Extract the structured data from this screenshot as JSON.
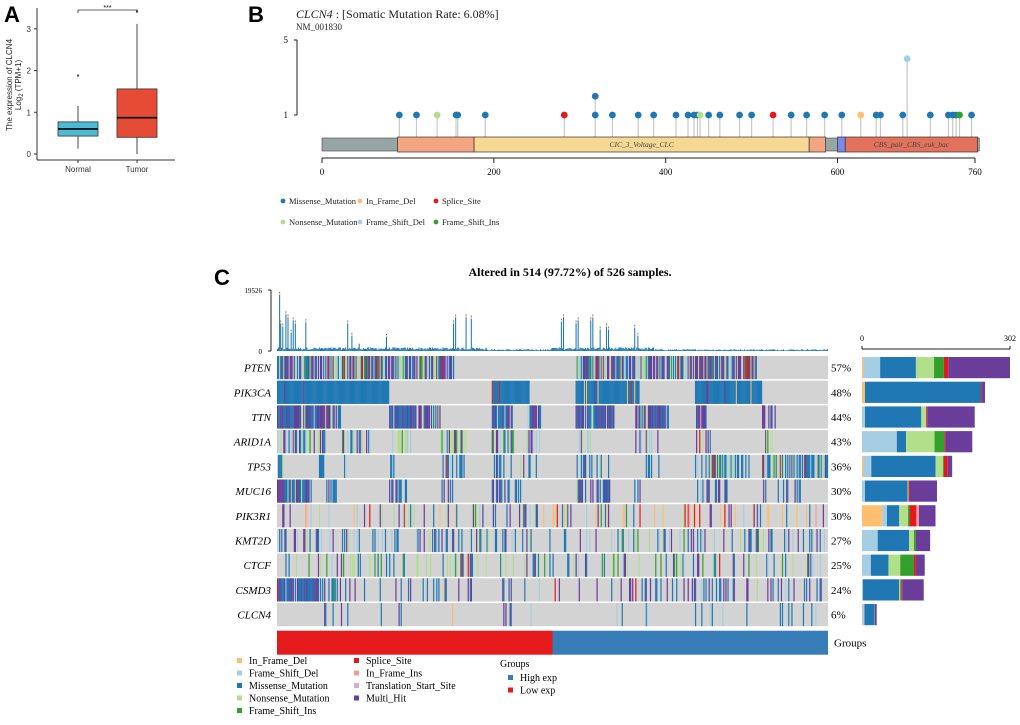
{
  "panels": {
    "a": "A",
    "b": "B",
    "c": "C"
  },
  "chart_data": [
    {
      "id": "A",
      "type": "box",
      "title": "",
      "ylabel_line1": "The expression of CLCN4",
      "ylabel_line2_base": "Log",
      "ylabel_line2_sub": "2",
      "ylabel_line2_rest": " (TPM+1)",
      "ylim": [
        0,
        3.5
      ],
      "yticks": [
        0,
        1,
        2,
        3
      ],
      "categories": [
        "Normal",
        "Tumor"
      ],
      "significance": "***",
      "boxes": [
        {
          "name": "Normal",
          "color": "#4DBBD5",
          "min": 0.13,
          "q1": 0.43,
          "median": 0.6,
          "q3": 0.77,
          "max": 1.15,
          "outliers": [
            1.88
          ]
        },
        {
          "name": "Tumor",
          "color": "#E64B35",
          "min": 0.0,
          "q1": 0.4,
          "median": 0.87,
          "q3": 1.56,
          "max": 3.12,
          "outliers": [
            3.42
          ]
        }
      ]
    },
    {
      "id": "B",
      "type": "lollipop",
      "gene": "CLCN4",
      "title_rest": " : [Somatic Mutation Rate: 6.08%]",
      "transcript": "NM_001830",
      "xlim": [
        0,
        760
      ],
      "xticks": [
        0,
        200,
        400,
        600,
        760
      ],
      "yticks": [
        1,
        5
      ],
      "domains": [
        {
          "name": "",
          "start": 88,
          "end": 177,
          "color": "#F4A582"
        },
        {
          "name": "CIC_3_Voltage_CLC",
          "start": 177,
          "end": 567,
          "color": "#F7D794"
        },
        {
          "name": "",
          "start": 567,
          "end": 586,
          "color": "#F4A582"
        },
        {
          "name": "",
          "start": 600,
          "end": 609,
          "color": "#7B87E8"
        },
        {
          "name": "CBS_pair_CBS_euk_bac",
          "start": 609,
          "end": 763,
          "color": "#E2725B"
        }
      ],
      "mutations": [
        {
          "pos": 90,
          "count": 1,
          "type": "Missense_Mutation"
        },
        {
          "pos": 110,
          "count": 1,
          "type": "Missense_Mutation"
        },
        {
          "pos": 134,
          "count": 1,
          "type": "Nonsense_Mutation"
        },
        {
          "pos": 156,
          "count": 1,
          "type": "Missense_Mutation"
        },
        {
          "pos": 158,
          "count": 1,
          "type": "Missense_Mutation"
        },
        {
          "pos": 190,
          "count": 1,
          "type": "Missense_Mutation"
        },
        {
          "pos": 282,
          "count": 1,
          "type": "Splice_Site"
        },
        {
          "pos": 318,
          "count": 2,
          "type": "Missense_Mutation"
        },
        {
          "pos": 338,
          "count": 1,
          "type": "Missense_Mutation"
        },
        {
          "pos": 368,
          "count": 1,
          "type": "Missense_Mutation"
        },
        {
          "pos": 386,
          "count": 1,
          "type": "Missense_Mutation"
        },
        {
          "pos": 412,
          "count": 1,
          "type": "Missense_Mutation"
        },
        {
          "pos": 426,
          "count": 1,
          "type": "Missense_Mutation"
        },
        {
          "pos": 433,
          "count": 1,
          "type": "Missense_Mutation"
        },
        {
          "pos": 437,
          "count": 1,
          "type": "Missense_Mutation"
        },
        {
          "pos": 440,
          "count": 1,
          "type": "Nonsense_Mutation"
        },
        {
          "pos": 450,
          "count": 1,
          "type": "Missense_Mutation"
        },
        {
          "pos": 463,
          "count": 1,
          "type": "Missense_Mutation"
        },
        {
          "pos": 486,
          "count": 1,
          "type": "Missense_Mutation"
        },
        {
          "pos": 500,
          "count": 1,
          "type": "Missense_Mutation"
        },
        {
          "pos": 525,
          "count": 1,
          "type": "Splice_Site"
        },
        {
          "pos": 546,
          "count": 1,
          "type": "Missense_Mutation"
        },
        {
          "pos": 564,
          "count": 1,
          "type": "Missense_Mutation"
        },
        {
          "pos": 585,
          "count": 1,
          "type": "Missense_Mutation"
        },
        {
          "pos": 605,
          "count": 1,
          "type": "Missense_Mutation"
        },
        {
          "pos": 627,
          "count": 1,
          "type": "In_Frame_Del"
        },
        {
          "pos": 645,
          "count": 1,
          "type": "Missense_Mutation"
        },
        {
          "pos": 650,
          "count": 1,
          "type": "Missense_Mutation"
        },
        {
          "pos": 676,
          "count": 1,
          "type": "Missense_Mutation"
        },
        {
          "pos": 681,
          "count": 4,
          "type": "Frame_Shift_Del"
        },
        {
          "pos": 708,
          "count": 1,
          "type": "Missense_Mutation"
        },
        {
          "pos": 729,
          "count": 1,
          "type": "Missense_Mutation"
        },
        {
          "pos": 734,
          "count": 1,
          "type": "Missense_Mutation"
        },
        {
          "pos": 738,
          "count": 1,
          "type": "Missense_Mutation"
        },
        {
          "pos": 742,
          "count": 1,
          "type": "Frame_Shift_Ins"
        },
        {
          "pos": 756,
          "count": 1,
          "type": "Missense_Mutation"
        }
      ],
      "legend": [
        {
          "label": "Missense_Mutation",
          "color": "#1F78B4"
        },
        {
          "label": "In_Frame_Del",
          "color": "#FDBF6F"
        },
        {
          "label": "Splice_Site",
          "color": "#E31A1C"
        },
        {
          "label": "Nonsense_Mutation",
          "color": "#B2DF8A"
        },
        {
          "label": "Frame_Shift_Del",
          "color": "#A6CEE3"
        },
        {
          "label": "Frame_Shift_Ins",
          "color": "#33A02C"
        }
      ]
    },
    {
      "id": "C",
      "type": "heatmap",
      "title": "Altered in 514 (97.72%) of 526 samples.",
      "tmb_axis": {
        "max": 19526,
        "min": 0
      },
      "count_axis": {
        "min": 0,
        "max": 302
      },
      "genes": [
        {
          "name": "PTEN",
          "pct": "57%",
          "counts": {
            "In_Frame_Del": 3,
            "Frame_Shift_Del": 34,
            "Missense_Mutation": 73,
            "Nonsense_Mutation": 37,
            "Frame_Shift_Ins": 20,
            "Splice_Site": 9,
            "Multi_Hit": 126
          }
        },
        {
          "name": "PIK3CA",
          "pct": "48%",
          "counts": {
            "In_Frame_Del": 6,
            "Missense_Mutation": 237,
            "Splice_Site": 2,
            "Multi_Hit": 6
          }
        },
        {
          "name": "TTN",
          "pct": "44%",
          "counts": {
            "Frame_Shift_Del": 6,
            "Missense_Mutation": 115,
            "Nonsense_Mutation": 10,
            "Splice_Site": 2,
            "Multi_Hit": 97
          }
        },
        {
          "name": "ARID1A",
          "pct": "43%",
          "counts": {
            "Frame_Shift_Del": 71,
            "Missense_Mutation": 19,
            "Nonsense_Mutation": 58,
            "Frame_Shift_Ins": 20,
            "Splice_Site": 2,
            "Multi_Hit": 55
          }
        },
        {
          "name": "TP53",
          "pct": "36%",
          "counts": {
            "In_Frame_Del": 3,
            "Frame_Shift_Del": 16,
            "Missense_Mutation": 131,
            "Nonsense_Mutation": 15,
            "Frame_Shift_Ins": 2,
            "Splice_Site": 8,
            "Multi_Hit": 9
          }
        },
        {
          "name": "MUC16",
          "pct": "30%",
          "counts": {
            "Frame_Shift_Del": 6,
            "Missense_Mutation": 87,
            "Nonsense_Mutation": 2,
            "Splice_Site": 2,
            "Multi_Hit": 56
          }
        },
        {
          "name": "PIK3R1",
          "pct": "30%",
          "counts": {
            "In_Frame_Del": 41,
            "Frame_Shift_Del": 10,
            "Missense_Mutation": 25,
            "Nonsense_Mutation": 18,
            "Frame_Shift_Ins": 3,
            "Splice_Site": 14,
            "In_Frame_Ins": 5,
            "Multi_Hit": 34
          }
        },
        {
          "name": "KMT2D",
          "pct": "27%",
          "counts": {
            "Frame_Shift_Del": 32,
            "Missense_Mutation": 64,
            "Nonsense_Mutation": 10,
            "Frame_Shift_Ins": 4,
            "Multi_Hit": 29
          }
        },
        {
          "name": "CTCF",
          "pct": "25%",
          "counts": {
            "Frame_Shift_Del": 18,
            "Missense_Mutation": 36,
            "Nonsense_Mutation": 24,
            "Frame_Shift_Ins": 28,
            "Splice_Site": 4,
            "Multi_Hit": 18
          }
        },
        {
          "name": "CSMD3",
          "pct": "24%",
          "counts": {
            "Frame_Shift_Del": 2,
            "Missense_Mutation": 74,
            "Nonsense_Mutation": 2,
            "Frame_Shift_Ins": 2,
            "Splice_Site": 2,
            "Multi_Hit": 44
          }
        },
        {
          "name": "CLCN4",
          "pct": "6%",
          "counts": {
            "In_Frame_Del": 1,
            "Frame_Shift_Del": 4,
            "Missense_Mutation": 20,
            "Frame_Shift_Ins": 1,
            "Multi_Hit": 4
          }
        }
      ],
      "groups_label": "Groups",
      "groups": [
        {
          "name": "Low exp",
          "color": "#E41A1C",
          "fraction": 0.5
        },
        {
          "name": "High exp",
          "color": "#377EB8",
          "fraction": 0.5
        }
      ],
      "variant_legend": [
        {
          "label": "In_Frame_Del",
          "color": "#FDBF6F"
        },
        {
          "label": "Frame_Shift_Del",
          "color": "#A6CEE3"
        },
        {
          "label": "Missense_Mutation",
          "color": "#1F78B4"
        },
        {
          "label": "Nonsense_Mutation",
          "color": "#B2DF8A"
        },
        {
          "label": "Frame_Shift_Ins",
          "color": "#33A02C"
        },
        {
          "label": "Splice_Site",
          "color": "#E31A1C"
        },
        {
          "label": "In_Frame_Ins",
          "color": "#FB9A99"
        },
        {
          "label": "Translation_Start_Site",
          "color": "#CAB2D6"
        },
        {
          "label": "Multi_Hit",
          "color": "#6A3D9A"
        }
      ],
      "group_legend_title": "Groups",
      "group_legend": [
        {
          "label": "High exp",
          "color": "#377EB8"
        },
        {
          "label": "Low exp",
          "color": "#E41A1C"
        }
      ]
    }
  ]
}
